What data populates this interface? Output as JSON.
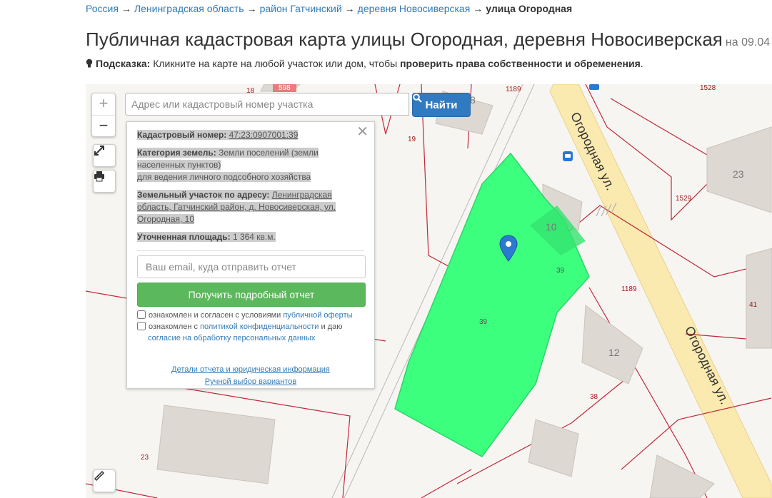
{
  "breadcrumb": {
    "items": [
      "Россия",
      "Ленинградская область",
      "район Гатчинский",
      "деревня Новосиверская"
    ],
    "separator": "→",
    "current": "улица Огородная"
  },
  "page": {
    "title": "Публичная кадастровая карта улицы Огородная, деревня Новосиверская",
    "date": "на 09.04"
  },
  "hint": {
    "label": "Подсказка:",
    "text": "Кликните на карте на любой участок или дом, чтобы",
    "bold": "проверить права собственности и обременения",
    "end": "."
  },
  "search": {
    "placeholder": "Адрес или кадастровый номер участка",
    "button": "Найти"
  },
  "zoom": {
    "in": "+",
    "out": "−"
  },
  "panel": {
    "cad_label": "Кадастровый номер:",
    "cad_value": "47:23:0907001:39",
    "cat_label": "Категория земель:",
    "cat_value_1": "Земли поселений (земли",
    "cat_value_2": "населенных пунктов)",
    "cat_value_3": "для ведения личного подсобного хозяйства",
    "addr_label": "Земельный участок по адресу:",
    "addr_value_1": "Ленинградская",
    "addr_value_2": "область, Гатчинский район, д. Новосиверская, ул.",
    "addr_value_3": "Огородная, 10",
    "area_label": "Уточненная площадь:",
    "area_value": "1 364 кв.м.",
    "email_placeholder": "Ваш email, куда отправить отчет",
    "report_button": "Получить подробный отчет",
    "agree1_text": "ознакомлен и согласен с условиями",
    "agree1_link": "публичной оферты",
    "agree2_text": "ознакомлен с",
    "agree2_link": "политикой конфиденциальности",
    "agree2_mid": "и даю",
    "agree2_link2": "согласие на обработку персональных данных",
    "details_link": "Детали отчета и юридическая информация",
    "manual_link": "Ручной выбор вариантов"
  },
  "map": {
    "street_label": "Огородная ул.",
    "parcel_numbers": [
      "598",
      "18",
      "8",
      "1189",
      "1528",
      "19",
      "23",
      "1529",
      "10",
      "39",
      "39",
      "1189",
      "41",
      "12",
      "38",
      "23"
    ],
    "colors": {
      "parcel": "#3cff7e",
      "road": "#fbeab0",
      "boundary": "#c0283a"
    }
  }
}
